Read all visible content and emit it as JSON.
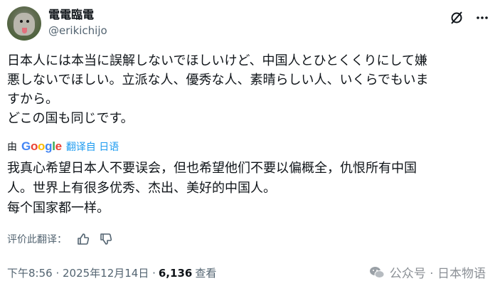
{
  "author": {
    "display_name": "電電臨電",
    "handle": "@erikichijo"
  },
  "tweet": {
    "text": "日本人には本当に誤解しないでほしいけど、中国人とひとくくりにして嫌\n悪しないでほしい。立派な人、優秀な人、素晴らしい人、いくらでもいま\nすから。\nどこの国も同じです。"
  },
  "translation": {
    "by_label": "由",
    "provider": "Google",
    "link_label": "翻译自 日语",
    "text": "我真心希望日本人不要误会，但也希望他们不要以偏概全，仇恨所有中国\n人。世界上有很多优秀、杰出、美好的中国人。\n每个国家都一样。",
    "rate_label": "评价此翻译："
  },
  "meta": {
    "timestamp": "下午8:56 · 2025年12月14日 ·",
    "views_count": "6,136",
    "views_label": "查看"
  },
  "watermark": {
    "text": "公众号 · 日本物语"
  },
  "icons": {
    "grok": "grok-slash-icon",
    "more": "more-icon",
    "thumb_up": "thumb-up-icon",
    "thumb_down": "thumb-down-icon",
    "wechat": "wechat-icon"
  },
  "colors": {
    "link": "#1d9bf0",
    "secondary_text": "#536471",
    "primary_text": "#0f1419"
  }
}
